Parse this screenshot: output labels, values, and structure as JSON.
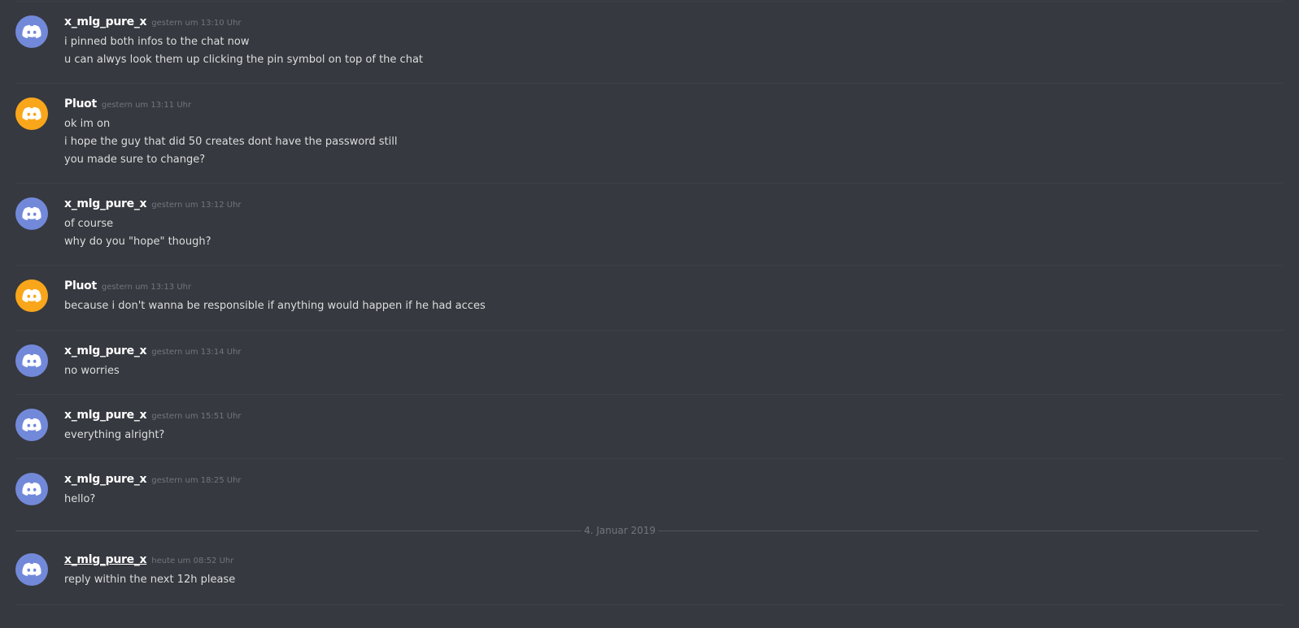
{
  "colors": {
    "background": "#36393f",
    "avatar_blurple": "#7289da",
    "avatar_orange": "#faa61a",
    "username": "#ffffff",
    "timestamp": "#72767d",
    "message_text": "#dcddde"
  },
  "messages": [
    {
      "author": "x_mlg_pure_x",
      "avatar": "discord-logo-blurple",
      "timestamp": "gestern um 13:10 Uhr",
      "lines": [
        "i pinned both infos to the chat now",
        "u can alwys look them up clicking the pin symbol on top of the chat"
      ]
    },
    {
      "author": "Pluot",
      "avatar": "discord-logo-orange",
      "timestamp": "gestern um 13:11 Uhr",
      "lines": [
        "ok im on",
        "i hope the guy that did 50 creates dont have the password still",
        "you made sure to change?"
      ]
    },
    {
      "author": "x_mlg_pure_x",
      "avatar": "discord-logo-blurple",
      "timestamp": "gestern um 13:12 Uhr",
      "lines": [
        "of course",
        "why do you \"hope\" though?"
      ]
    },
    {
      "author": "Pluot",
      "avatar": "discord-logo-orange",
      "timestamp": "gestern um 13:13 Uhr",
      "lines": [
        "because i don't wanna be responsible if anything would happen if he had acces"
      ]
    },
    {
      "author": "x_mlg_pure_x",
      "avatar": "discord-logo-blurple",
      "timestamp": "gestern um 13:14 Uhr",
      "lines": [
        "no worries"
      ]
    },
    {
      "author": "x_mlg_pure_x",
      "avatar": "discord-logo-blurple",
      "timestamp": "gestern um 15:51 Uhr",
      "lines": [
        "everything alright?"
      ]
    },
    {
      "author": "x_mlg_pure_x",
      "avatar": "discord-logo-blurple",
      "timestamp": "gestern um 18:25 Uhr",
      "lines": [
        "hello?"
      ]
    },
    {
      "author": "x_mlg_pure_x",
      "avatar": "discord-logo-blurple",
      "timestamp": "heute um 08:52 Uhr",
      "lines": [
        "reply within the next 12h please"
      ]
    }
  ],
  "date_separator": "4. Januar 2019"
}
